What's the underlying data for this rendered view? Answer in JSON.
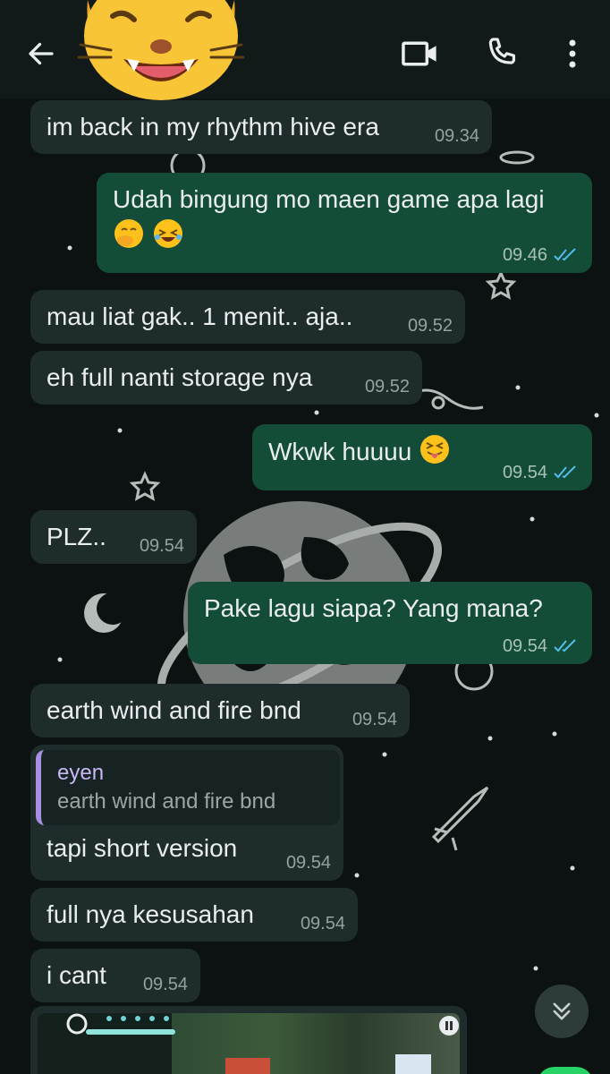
{
  "header": {
    "back_icon": "arrow-left-icon",
    "avatar": "cat-face-emoji",
    "video_icon": "video-camera-icon",
    "call_icon": "phone-icon",
    "menu_icon": "more-vertical-icon",
    "background": "#111a19"
  },
  "messages": [
    {
      "dir": "in",
      "text": "im back in my rhythm hive era",
      "time": "09.34"
    },
    {
      "dir": "out",
      "text": "Udah bingung mo maen game apa lagi",
      "emojis": [
        "hand-over-mouth-emoji",
        "rolling-laughing-emoji"
      ],
      "time": "09.46",
      "status": "read"
    },
    {
      "dir": "in",
      "text": "mau liat gak.. 1 menit.. aja..",
      "time": "09.52"
    },
    {
      "dir": "in",
      "text": "eh full nanti storage nya",
      "time": "09.52"
    },
    {
      "dir": "out",
      "text": "Wkwk huuuu",
      "emojis": [
        "squinting-tongue-emoji"
      ],
      "time": "09.54",
      "status": "read"
    },
    {
      "dir": "in",
      "text": "PLZ..",
      "time": "09.54"
    },
    {
      "dir": "out",
      "text": "Pake lagu siapa? Yang mana?",
      "time": "09.54",
      "status": "read"
    },
    {
      "dir": "in",
      "text": "earth wind and fire bnd",
      "time": "09.54"
    },
    {
      "dir": "in",
      "quote": {
        "author": "eyen",
        "text": "earth wind and fire bnd"
      },
      "text": "tapi short version",
      "time": "09.54"
    },
    {
      "dir": "in",
      "text": "full nya kesusahan",
      "time": "09.54"
    },
    {
      "dir": "in",
      "text": "i cant",
      "time": "09.54"
    }
  ],
  "media": {
    "type": "video-thumbnail",
    "icon": "pause-icon"
  },
  "scroll_button_icon": "double-chevron-down-icon",
  "colors": {
    "incoming": "#1f2c2c",
    "outgoing": "#144d37",
    "read_ticks": "#53bdeb",
    "accent": "#25d366"
  }
}
